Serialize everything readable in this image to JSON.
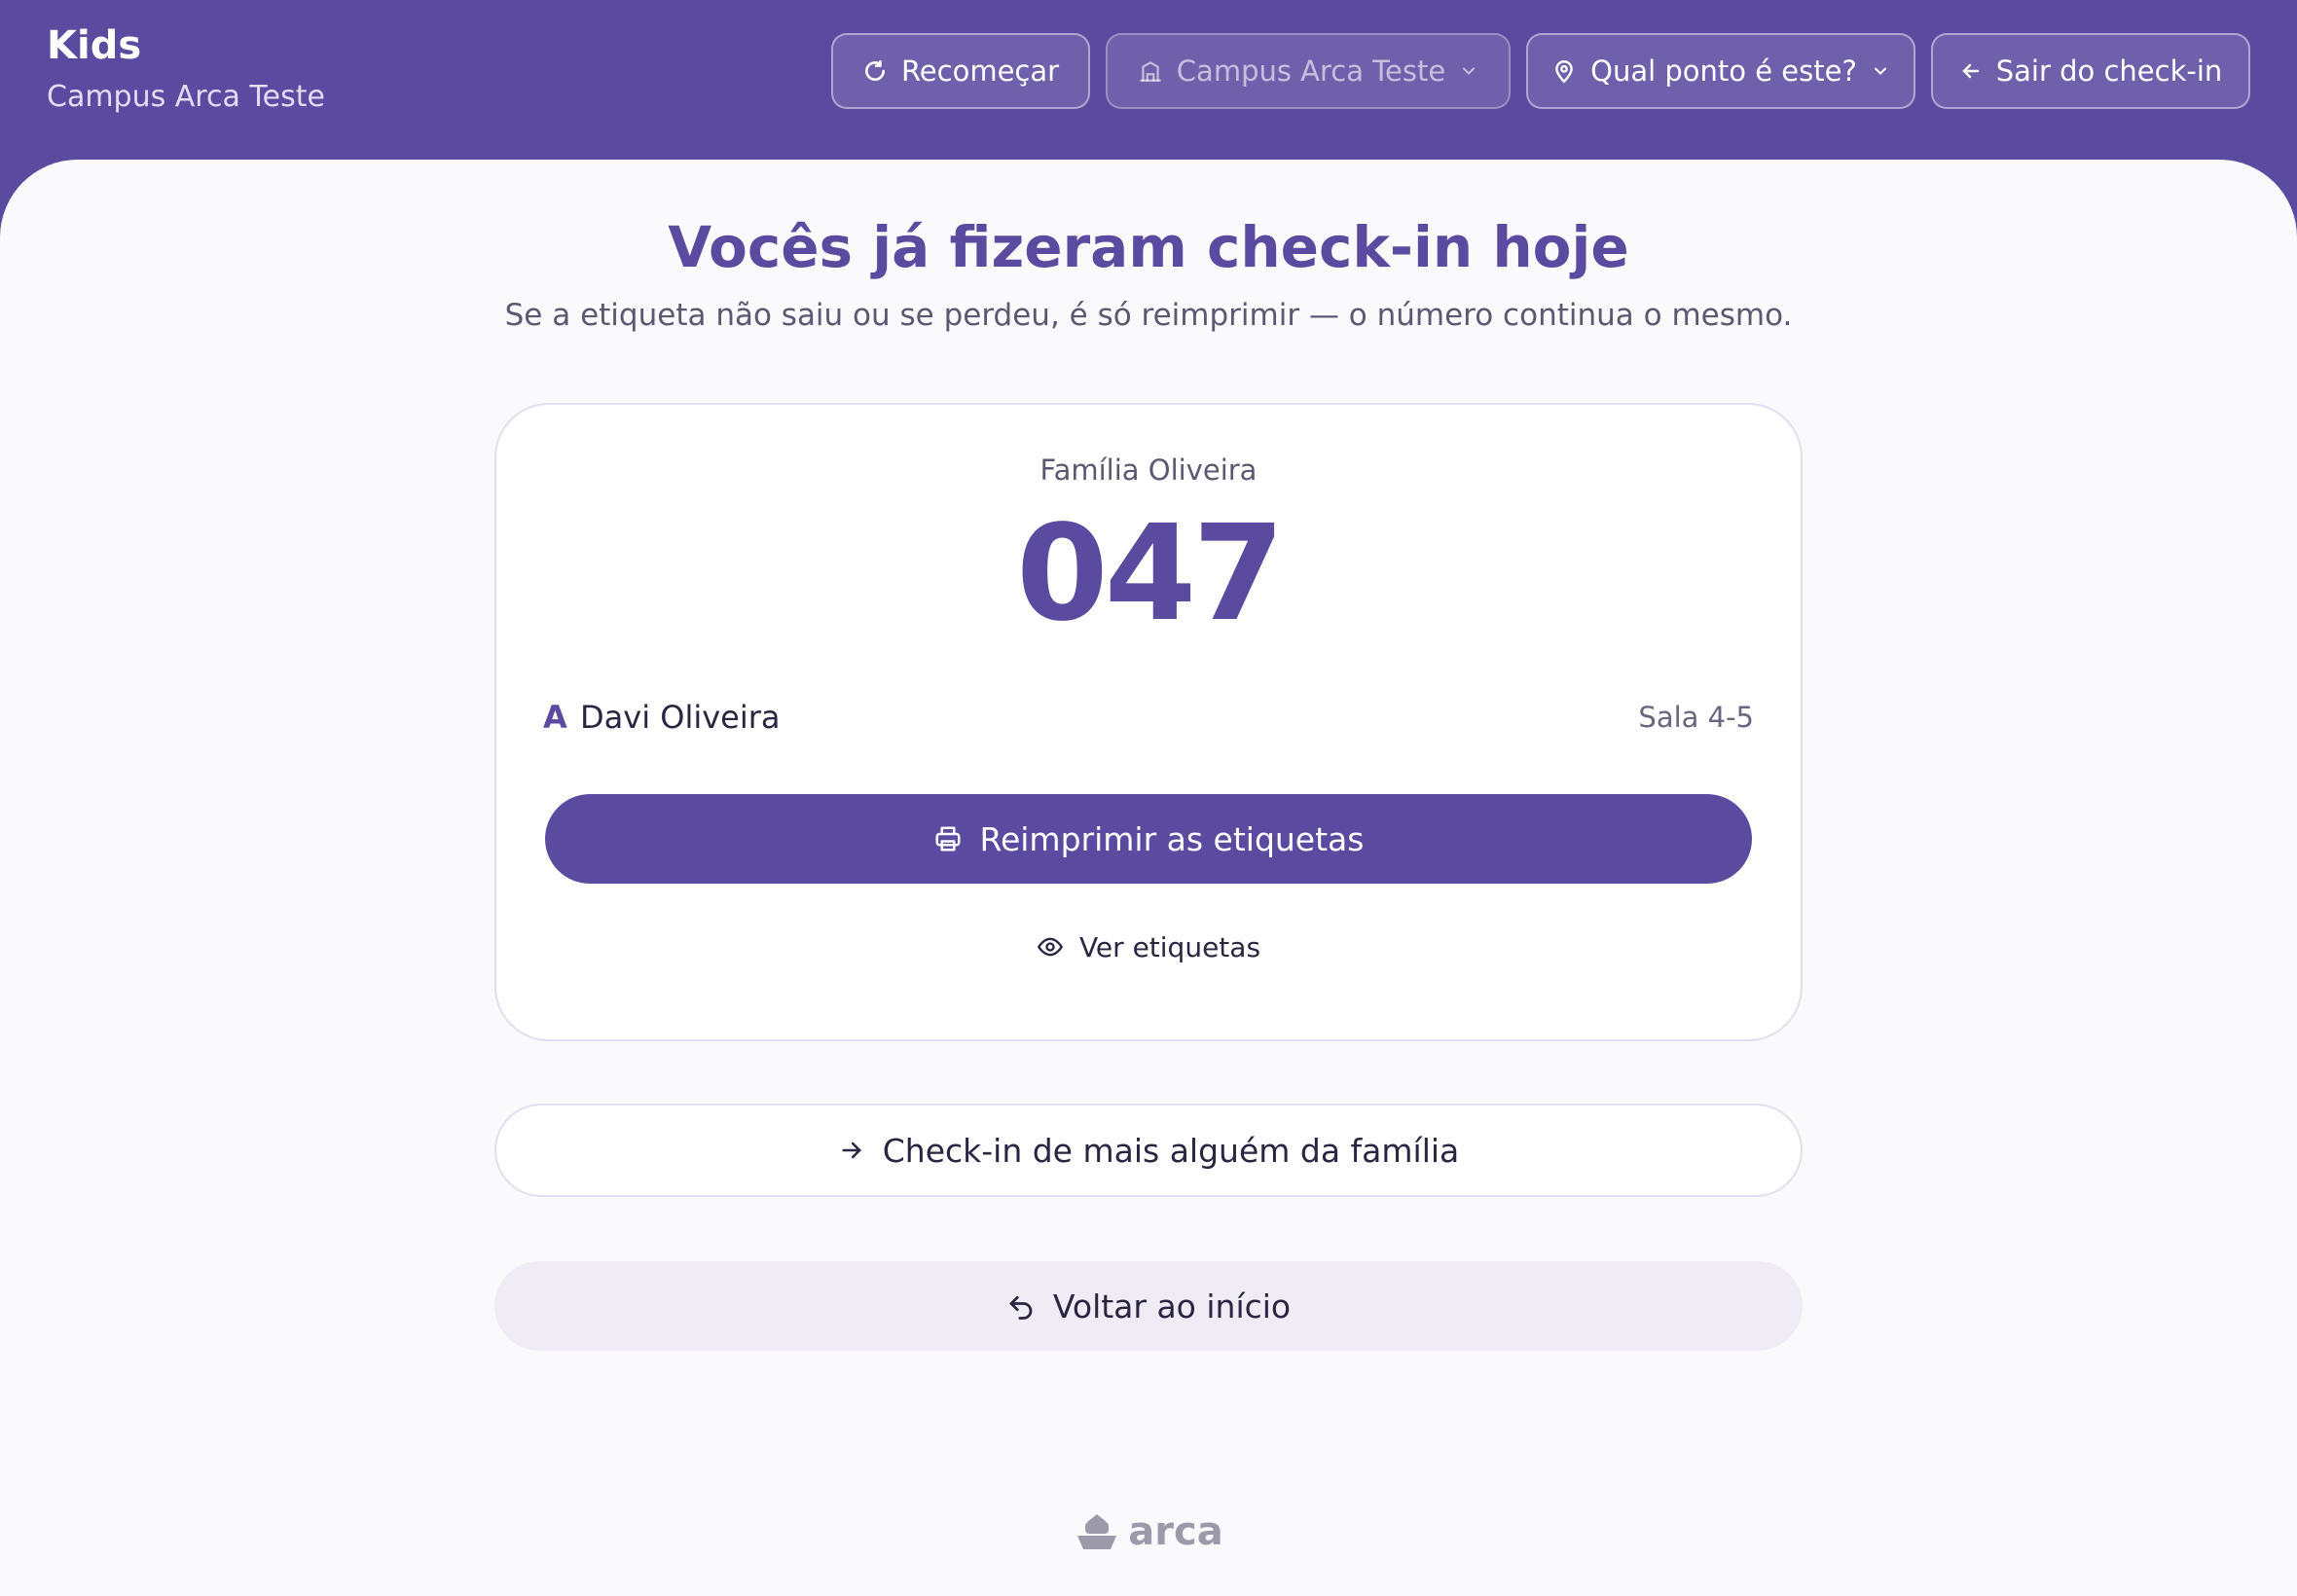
{
  "header": {
    "title": "Kids",
    "subtitle": "Campus Arca Teste",
    "restart_label": "Recomeçar",
    "campus_select": "Campus Arca Teste",
    "point_select": "Qual ponto é este?",
    "exit_label": "Sair do check-in"
  },
  "main": {
    "title": "Vocês já fizeram check-in hoje",
    "subtitle": "Se a etiqueta não saiu ou se perdeu, é só reimprimir — o número continua o mesmo."
  },
  "card": {
    "family_name": "Família Oliveira",
    "code": "047",
    "child": {
      "initial": "A",
      "name": "Davi Oliveira",
      "room": "Sala 4-5"
    },
    "reprint_label": "Reimprimir as etiquetas",
    "view_label": "Ver etiquetas"
  },
  "actions": {
    "family_more_label": "Check-in de mais alguém da família",
    "back_home_label": "Voltar ao início"
  },
  "footer": {
    "logo_text": "arca"
  },
  "colors": {
    "primary": "#5a4aa0",
    "background": "#fafafd",
    "secondary_button": "#efecf6"
  }
}
